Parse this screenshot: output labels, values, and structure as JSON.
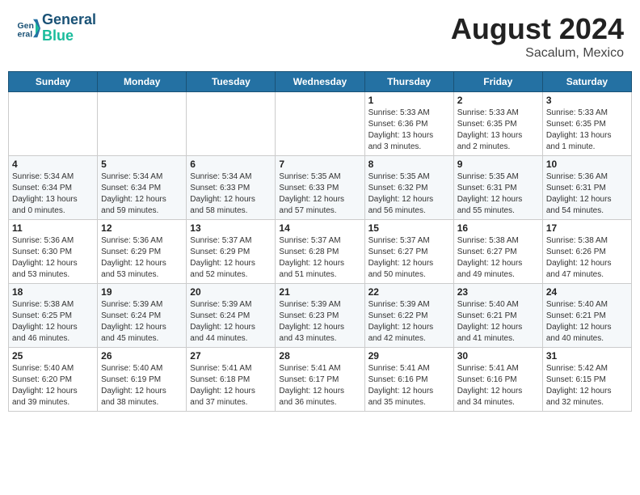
{
  "logo": {
    "line1": "General",
    "line2": "Blue"
  },
  "title": "August 2024",
  "location": "Sacalum, Mexico",
  "days_of_week": [
    "Sunday",
    "Monday",
    "Tuesday",
    "Wednesday",
    "Thursday",
    "Friday",
    "Saturday"
  ],
  "weeks": [
    [
      {
        "day": "",
        "info": ""
      },
      {
        "day": "",
        "info": ""
      },
      {
        "day": "",
        "info": ""
      },
      {
        "day": "",
        "info": ""
      },
      {
        "day": "1",
        "info": "Sunrise: 5:33 AM\nSunset: 6:36 PM\nDaylight: 13 hours\nand 3 minutes."
      },
      {
        "day": "2",
        "info": "Sunrise: 5:33 AM\nSunset: 6:35 PM\nDaylight: 13 hours\nand 2 minutes."
      },
      {
        "day": "3",
        "info": "Sunrise: 5:33 AM\nSunset: 6:35 PM\nDaylight: 13 hours\nand 1 minute."
      }
    ],
    [
      {
        "day": "4",
        "info": "Sunrise: 5:34 AM\nSunset: 6:34 PM\nDaylight: 13 hours\nand 0 minutes."
      },
      {
        "day": "5",
        "info": "Sunrise: 5:34 AM\nSunset: 6:34 PM\nDaylight: 12 hours\nand 59 minutes."
      },
      {
        "day": "6",
        "info": "Sunrise: 5:34 AM\nSunset: 6:33 PM\nDaylight: 12 hours\nand 58 minutes."
      },
      {
        "day": "7",
        "info": "Sunrise: 5:35 AM\nSunset: 6:33 PM\nDaylight: 12 hours\nand 57 minutes."
      },
      {
        "day": "8",
        "info": "Sunrise: 5:35 AM\nSunset: 6:32 PM\nDaylight: 12 hours\nand 56 minutes."
      },
      {
        "day": "9",
        "info": "Sunrise: 5:35 AM\nSunset: 6:31 PM\nDaylight: 12 hours\nand 55 minutes."
      },
      {
        "day": "10",
        "info": "Sunrise: 5:36 AM\nSunset: 6:31 PM\nDaylight: 12 hours\nand 54 minutes."
      }
    ],
    [
      {
        "day": "11",
        "info": "Sunrise: 5:36 AM\nSunset: 6:30 PM\nDaylight: 12 hours\nand 53 minutes."
      },
      {
        "day": "12",
        "info": "Sunrise: 5:36 AM\nSunset: 6:29 PM\nDaylight: 12 hours\nand 53 minutes."
      },
      {
        "day": "13",
        "info": "Sunrise: 5:37 AM\nSunset: 6:29 PM\nDaylight: 12 hours\nand 52 minutes."
      },
      {
        "day": "14",
        "info": "Sunrise: 5:37 AM\nSunset: 6:28 PM\nDaylight: 12 hours\nand 51 minutes."
      },
      {
        "day": "15",
        "info": "Sunrise: 5:37 AM\nSunset: 6:27 PM\nDaylight: 12 hours\nand 50 minutes."
      },
      {
        "day": "16",
        "info": "Sunrise: 5:38 AM\nSunset: 6:27 PM\nDaylight: 12 hours\nand 49 minutes."
      },
      {
        "day": "17",
        "info": "Sunrise: 5:38 AM\nSunset: 6:26 PM\nDaylight: 12 hours\nand 47 minutes."
      }
    ],
    [
      {
        "day": "18",
        "info": "Sunrise: 5:38 AM\nSunset: 6:25 PM\nDaylight: 12 hours\nand 46 minutes."
      },
      {
        "day": "19",
        "info": "Sunrise: 5:39 AM\nSunset: 6:24 PM\nDaylight: 12 hours\nand 45 minutes."
      },
      {
        "day": "20",
        "info": "Sunrise: 5:39 AM\nSunset: 6:24 PM\nDaylight: 12 hours\nand 44 minutes."
      },
      {
        "day": "21",
        "info": "Sunrise: 5:39 AM\nSunset: 6:23 PM\nDaylight: 12 hours\nand 43 minutes."
      },
      {
        "day": "22",
        "info": "Sunrise: 5:39 AM\nSunset: 6:22 PM\nDaylight: 12 hours\nand 42 minutes."
      },
      {
        "day": "23",
        "info": "Sunrise: 5:40 AM\nSunset: 6:21 PM\nDaylight: 12 hours\nand 41 minutes."
      },
      {
        "day": "24",
        "info": "Sunrise: 5:40 AM\nSunset: 6:21 PM\nDaylight: 12 hours\nand 40 minutes."
      }
    ],
    [
      {
        "day": "25",
        "info": "Sunrise: 5:40 AM\nSunset: 6:20 PM\nDaylight: 12 hours\nand 39 minutes."
      },
      {
        "day": "26",
        "info": "Sunrise: 5:40 AM\nSunset: 6:19 PM\nDaylight: 12 hours\nand 38 minutes."
      },
      {
        "day": "27",
        "info": "Sunrise: 5:41 AM\nSunset: 6:18 PM\nDaylight: 12 hours\nand 37 minutes."
      },
      {
        "day": "28",
        "info": "Sunrise: 5:41 AM\nSunset: 6:17 PM\nDaylight: 12 hours\nand 36 minutes."
      },
      {
        "day": "29",
        "info": "Sunrise: 5:41 AM\nSunset: 6:16 PM\nDaylight: 12 hours\nand 35 minutes."
      },
      {
        "day": "30",
        "info": "Sunrise: 5:41 AM\nSunset: 6:16 PM\nDaylight: 12 hours\nand 34 minutes."
      },
      {
        "day": "31",
        "info": "Sunrise: 5:42 AM\nSunset: 6:15 PM\nDaylight: 12 hours\nand 32 minutes."
      }
    ]
  ]
}
